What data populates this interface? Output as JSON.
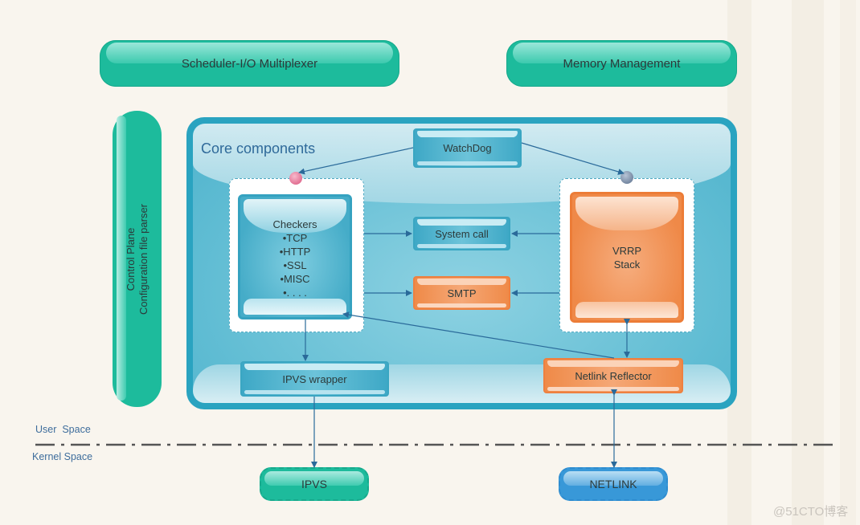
{
  "top": {
    "scheduler": "Scheduler-I/O Multiplexer",
    "memory": "Memory Management"
  },
  "control_plane": {
    "line1": "Control Plane",
    "line2": "Configuration file parser"
  },
  "core": {
    "title": "Core components",
    "watchdog": "WatchDog",
    "checkers": {
      "title": "Checkers",
      "items": [
        "•TCP",
        "•HTTP",
        "•SSL",
        "•MISC",
        "•. . . ."
      ]
    },
    "system_call": "System call",
    "smtp": "SMTP",
    "vrrp_line1": "VRRP",
    "vrrp_line2": "Stack",
    "ipvs_wrapper": "IPVS wrapper",
    "netlink_reflector": "Netlink Reflector"
  },
  "spaces": {
    "user": "User  Space",
    "kernel": "Kernel Space"
  },
  "kernel": {
    "ipvs": "IPVS",
    "netlink": "NETLINK"
  },
  "watermark": "@51CTO博客",
  "colors": {
    "green": "#1dbb9c",
    "core_blue": "#2aa3c0",
    "orange": "#ef8a48",
    "netlink_blue": "#3898d8",
    "arrow": "#2a6a9a"
  }
}
